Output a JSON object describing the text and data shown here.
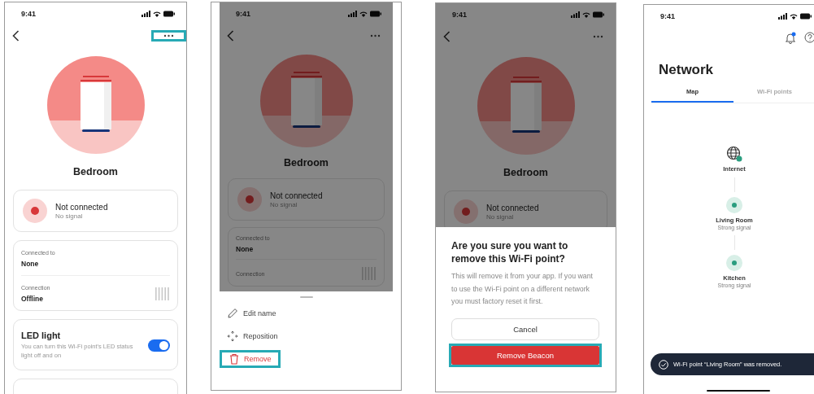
{
  "screens": [
    {
      "kind": "detail",
      "time": "9:41",
      "more_highlighted": true,
      "title": "Bedroom",
      "status": {
        "title": "Not connected",
        "subtitle": "No signal"
      },
      "info": [
        {
          "label": "Connected to",
          "value": "None",
          "signal_bars": false
        },
        {
          "label": "Connection",
          "value": "Offline",
          "signal_bars": true
        }
      ],
      "led": {
        "title": "LED light",
        "description": "You can turn this Wi-Fi point's LED status light off and on",
        "on": true
      },
      "more_cards": true
    },
    {
      "kind": "detail",
      "time": "9:41",
      "more_highlighted": false,
      "title": "Bedroom",
      "status": {
        "title": "Not connected",
        "subtitle": "No signal"
      },
      "info": [
        {
          "label": "Connected to",
          "value": "None",
          "signal_bars": false
        },
        {
          "label": "Connection",
          "signal_bars": true
        }
      ],
      "overlay": {
        "kind": "menu",
        "items": [
          {
            "kind": "edit",
            "label": "Edit name",
            "highlighted": false
          },
          {
            "kind": "move",
            "label": "Reposition",
            "highlighted": false
          },
          {
            "kind": "remove",
            "label": "Remove",
            "highlighted": true
          }
        ]
      }
    },
    {
      "kind": "detail",
      "time": "9:41",
      "more_highlighted": false,
      "title": "Bedroom",
      "status": {
        "title": "Not connected",
        "subtitle": "No signal"
      },
      "overlay": {
        "kind": "dialog",
        "title": "Are you sure you want to remove this Wi-Fi point?",
        "body": "This will remove it from your app. If you want to use the Wi-Fi point on a different network you must factory reset it first.",
        "buttons": [
          {
            "label": "Cancel",
            "kind": "secondary",
            "highlighted": false
          },
          {
            "label": "Remove Beacon",
            "kind": "danger",
            "highlighted": true
          }
        ]
      }
    },
    {
      "kind": "network",
      "time": "9:41",
      "notification_dot": true,
      "title": "Network",
      "tabs": [
        {
          "label": "Map",
          "selected": true
        },
        {
          "label": "Wi-Fi points",
          "selected": false
        }
      ],
      "nodes": [
        {
          "kind": "internet",
          "name": "Internet",
          "online": true
        },
        {
          "kind": "point",
          "name": "Living Room",
          "detail": "Strong signal"
        },
        {
          "kind": "point",
          "name": "Kitchen",
          "detail": "Strong signal"
        }
      ],
      "toast": "Wi-Fi point “Living Room” was removed."
    }
  ]
}
